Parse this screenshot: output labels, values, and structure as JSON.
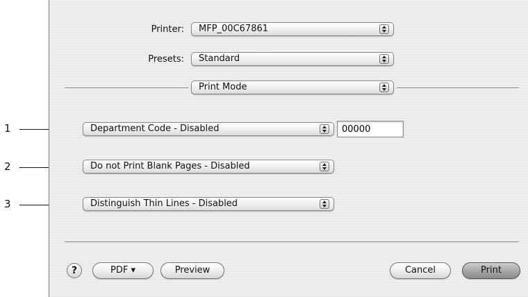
{
  "printer": {
    "label": "Printer:",
    "value": "MFP_00C67861"
  },
  "presets": {
    "label": "Presets:",
    "value": "Standard"
  },
  "pane": {
    "value": "Print Mode"
  },
  "options": [
    {
      "callout": "1",
      "value": "Department Code - Disabled",
      "field_value": "00000"
    },
    {
      "callout": "2",
      "value": "Do not Print Blank Pages - Disabled"
    },
    {
      "callout": "3",
      "value": "Distinguish Thin Lines - Disabled"
    }
  ],
  "buttons": {
    "help": "?",
    "pdf": "PDF ▾",
    "preview": "Preview",
    "cancel": "Cancel",
    "print": "Print"
  }
}
